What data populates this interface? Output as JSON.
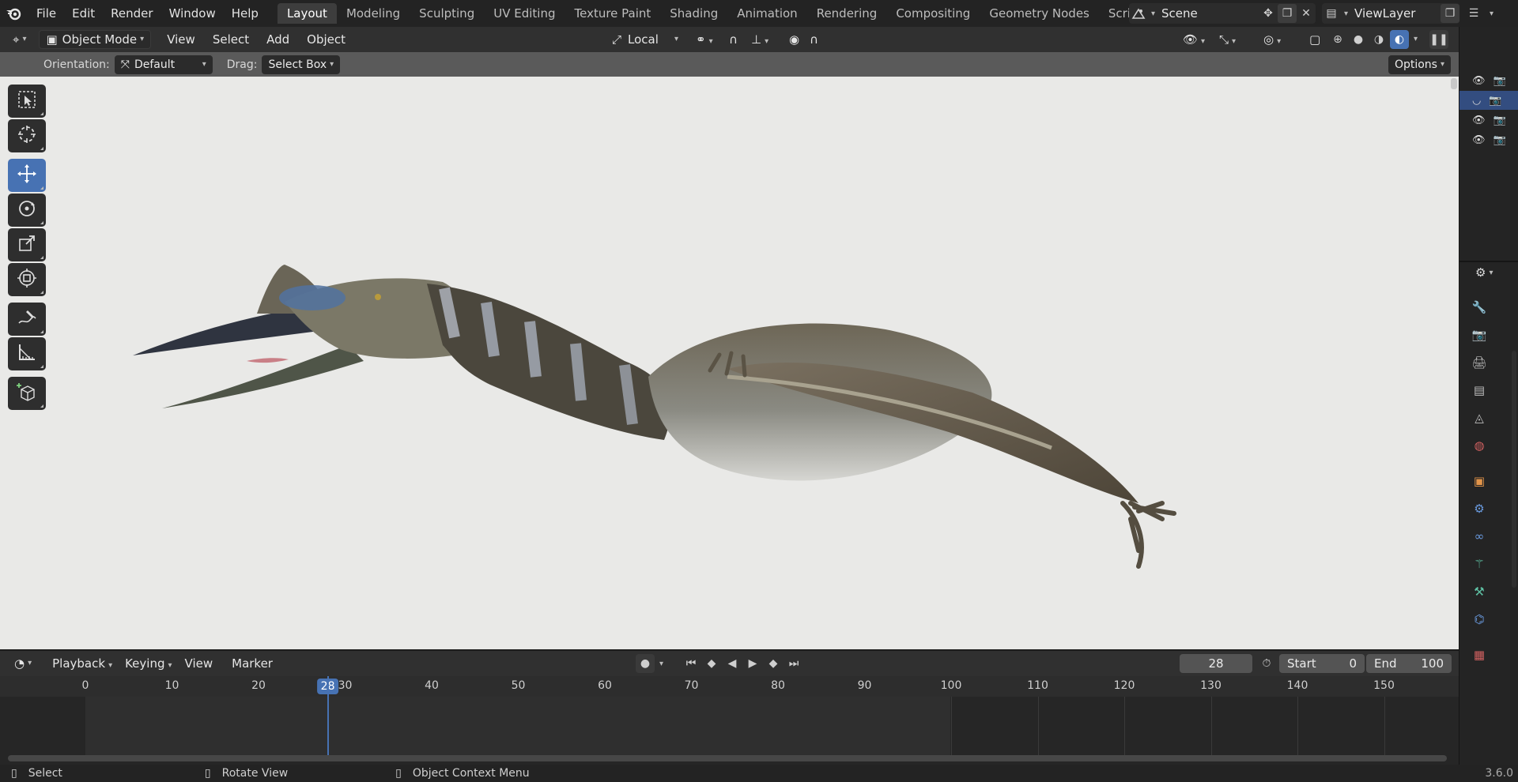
{
  "topbar": {
    "menus": [
      "File",
      "Edit",
      "Render",
      "Window",
      "Help"
    ],
    "workspaces": [
      "Layout",
      "Modeling",
      "Sculpting",
      "UV Editing",
      "Texture Paint",
      "Shading",
      "Animation",
      "Rendering",
      "Compositing",
      "Geometry Nodes",
      "Scripting"
    ],
    "active_workspace": "Layout",
    "scene_name": "Scene",
    "view_layer": "ViewLayer"
  },
  "viewport_header": {
    "mode": "Object Mode",
    "menus": [
      "View",
      "Select",
      "Add",
      "Object"
    ],
    "transform_orientation": "Local"
  },
  "tool_settings": {
    "orientation_label": "Orientation:",
    "orientation_value": "Default",
    "drag_label": "Drag:",
    "drag_value": "Select Box",
    "options_label": "Options"
  },
  "tools": [
    "select-box-icon",
    "cursor-icon",
    "move-icon",
    "rotate-icon",
    "scale-icon",
    "transform-icon",
    "annotate-icon",
    "measure-icon",
    "add-cube-icon"
  ],
  "timeline": {
    "menus": [
      "Playback",
      "Keying",
      "View",
      "Marker"
    ],
    "current_frame": "28",
    "start_label": "Start",
    "start_value": "0",
    "end_label": "End",
    "end_value": "100",
    "ticks": [
      "0",
      "10",
      "20",
      "30",
      "40",
      "50",
      "60",
      "70",
      "80",
      "90",
      "100",
      "110",
      "120",
      "130",
      "140",
      "150"
    ]
  },
  "statusbar": {
    "select": "Select",
    "rotate": "Rotate View",
    "context": "Object Context Menu",
    "version": "3.6.0"
  },
  "colors": {
    "accent": "#4772b3",
    "viewport_bg": "#e9e9e7"
  }
}
